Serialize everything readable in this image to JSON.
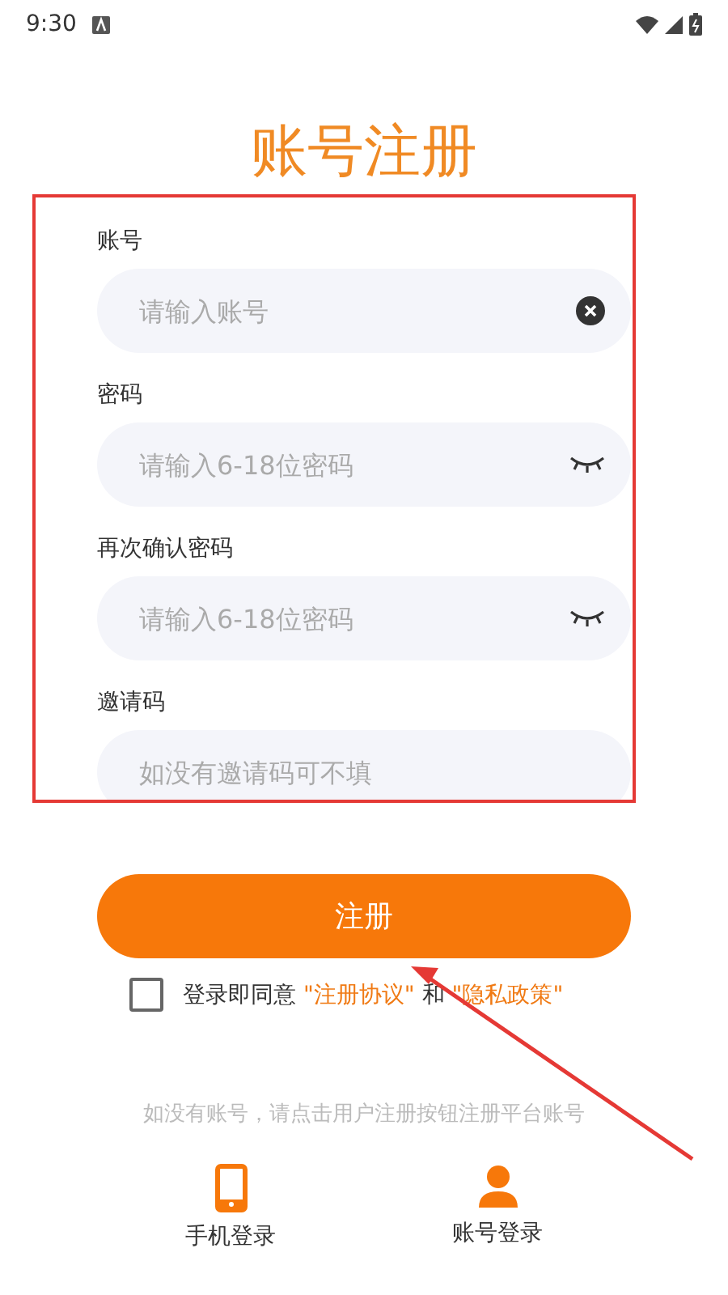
{
  "status_bar": {
    "time": "9:30"
  },
  "title": "账号注册",
  "fields": [
    {
      "label": "账号",
      "placeholder": "请输入账号",
      "kind": "clear"
    },
    {
      "label": "密码",
      "placeholder": "请输入6-18位密码",
      "kind": "hidden"
    },
    {
      "label": "再次确认密码",
      "placeholder": "请输入6-18位密码",
      "kind": "hidden"
    },
    {
      "label": "邀请码",
      "placeholder": "如没有邀请码可不填",
      "kind": "plain"
    }
  ],
  "submit": "注册",
  "agreement": {
    "checked": false,
    "parts": [
      {
        "text": "登录即同意 ",
        "kind": "text"
      },
      {
        "text": "\"注册协议\"",
        "kind": "link"
      },
      {
        "text": " 和 ",
        "kind": "text"
      },
      {
        "text": "\"隐私政策\"",
        "kind": "link"
      }
    ]
  },
  "hint": "如没有账号，请点击用户注册按钮注册平台账号",
  "login_options": [
    {
      "label": "手机登录",
      "kind": "phone"
    },
    {
      "label": "账号登录",
      "kind": "person"
    }
  ]
}
